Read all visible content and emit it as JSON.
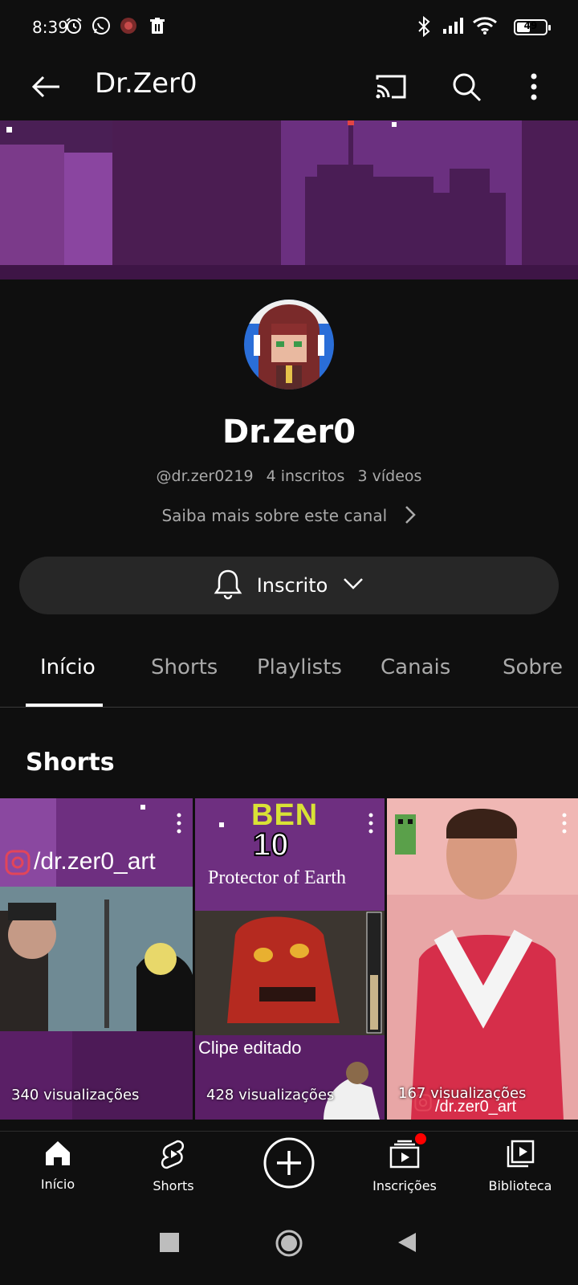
{
  "status_bar": {
    "time": "8:39",
    "battery_level": "49",
    "battery_fraction": 0.49
  },
  "app_bar": {
    "title": "Dr.Zer0",
    "icons": [
      "back-arrow-icon",
      "cast-icon",
      "search-icon",
      "more-vert-icon"
    ]
  },
  "channel": {
    "name": "Dr.Zer0",
    "handle": "@dr.zer0219",
    "subscribers": "4 inscritos",
    "videos": "3 vídeos",
    "more_about": "Saiba mais sobre este canal",
    "subscribe_label": "Inscrito"
  },
  "tabs": [
    {
      "label": "Início",
      "active": true
    },
    {
      "label": "Shorts",
      "active": false
    },
    {
      "label": "Playlists",
      "active": false
    },
    {
      "label": "Canais",
      "active": false
    },
    {
      "label": "Sobre",
      "active": false
    }
  ],
  "shorts_section": {
    "title": "Shorts",
    "items": [
      {
        "views": "340 visualizações",
        "overlay_text": "/dr.zer0_art"
      },
      {
        "views": "428 visualizações",
        "overlay_title_top": "BEN",
        "overlay_title_num": "10",
        "overlay_subtitle": "Protector of Earth",
        "caption": "Clipe editado"
      },
      {
        "views": "167 visualizações",
        "overlay_text": "/dr.zer0_art"
      }
    ]
  },
  "bottom_nav": [
    {
      "label": "Início",
      "icon": "home-icon"
    },
    {
      "label": "Shorts",
      "icon": "shorts-icon"
    },
    {
      "label": "",
      "icon": "create-plus-icon"
    },
    {
      "label": "Inscrições",
      "icon": "subscriptions-icon"
    },
    {
      "label": "Biblioteca",
      "icon": "library-icon"
    }
  ],
  "colors": {
    "background": "#0f0f0f",
    "banner_purple": "#5b2a6a",
    "button_gray": "#272727",
    "notification_red": "#ff0000"
  }
}
